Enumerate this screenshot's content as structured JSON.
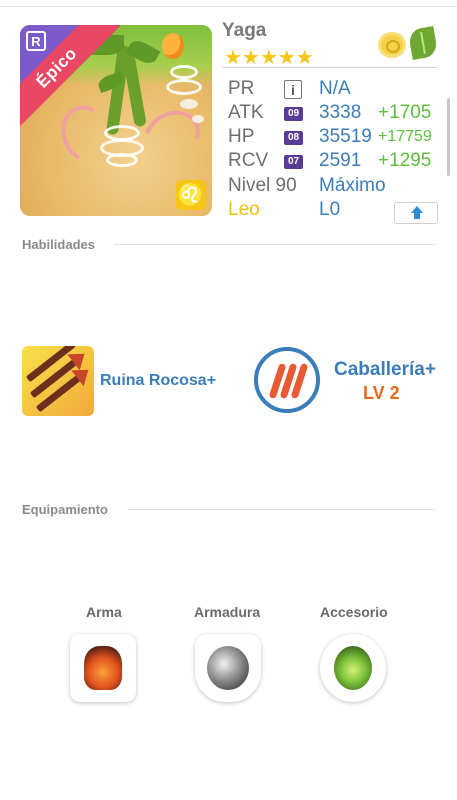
{
  "hero": {
    "name": "Yaga",
    "stars": "★★★★★",
    "rarity": "Épico",
    "rank_letter": "R",
    "zodiac_symbol": "♌",
    "elements": [
      "light-element-icon",
      "nature-leaf-icon"
    ]
  },
  "stats": {
    "pr": {
      "label": "PR",
      "value": "N/A"
    },
    "atk": {
      "label": "ATK",
      "rank": "09",
      "value": "3338",
      "bonus": "+1705"
    },
    "hp": {
      "label": "HP",
      "rank": "08",
      "value": "35519",
      "bonus": "+17759"
    },
    "rcv": {
      "label": "RCV",
      "rank": "07",
      "value": "2591",
      "bonus": "+1295"
    },
    "level": {
      "label": "Nivel 90",
      "value": "Máximo"
    },
    "sign": {
      "label": "Leo",
      "value": "L0"
    }
  },
  "sections": {
    "skills_title": "Habilidades",
    "equipment_title": "Equipamiento"
  },
  "skills": [
    {
      "name": "Ruina Rocosa+",
      "icon": "rock-arrows-icon"
    },
    {
      "name": "Caballería+",
      "level": "LV 2",
      "icon": "claw-marks-icon"
    }
  ],
  "equipment": [
    {
      "slot": "Arma",
      "icon": "fire-weapon-icon"
    },
    {
      "slot": "Armadura",
      "icon": "steel-armor-icon"
    },
    {
      "slot": "Accesorio",
      "icon": "nature-accessory-icon"
    }
  ],
  "colors": {
    "value_blue": "#3a7db8",
    "bonus_green": "#5cbf3c",
    "rarity_pink": "#e94763",
    "star_gold": "#f5c518",
    "leo_yellow": "#f2c10f",
    "skill_level_orange": "#e56a1c"
  }
}
